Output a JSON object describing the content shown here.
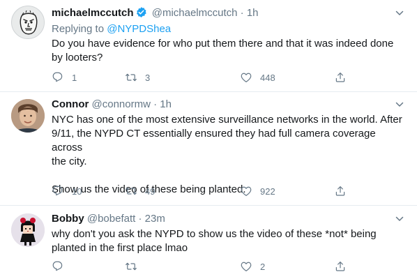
{
  "tweets": [
    {
      "name": "michaelmccutch",
      "verified": true,
      "handle": "@michaelmccutch",
      "separator": "·",
      "time": "1h",
      "replying_prefix": "Replying to",
      "replying_to": "@NYPDShea",
      "text_lines": [
        "Do you have evidence for who put them there and that it was indeed done",
        "by looters?"
      ],
      "replies": "1",
      "retweets": "3",
      "likes": "448"
    },
    {
      "name": "Connor",
      "handle": "@connormw",
      "separator": "·",
      "time": "1h",
      "text_lines": [
        "NYC has one of the most extensive surveillance networks in the world. After",
        "9/11, the NYPD CT essentially ensured they had full camera coverage across",
        "the city.",
        "",
        "Show us the video of these being planted."
      ],
      "replies": "10",
      "retweets": "49",
      "likes": "922"
    },
    {
      "name": "Bobby",
      "handle": "@bobefatt",
      "separator": "·",
      "time": "23m",
      "text_lines": [
        "why don't you ask the NYPD to show us the video of these *not* being",
        "planted in the first place lmao"
      ],
      "replies": "",
      "retweets": "",
      "likes": "2"
    }
  ],
  "icons": {
    "reply": "reply-icon",
    "retweet": "retweet-icon",
    "like": "heart-icon",
    "share": "share-icon",
    "more": "chevron-down-icon",
    "verified": "verified-badge-icon"
  },
  "colors": {
    "link": "#1da1f2",
    "muted": "#657786",
    "text": "#14171a",
    "divider": "#e6ecf0",
    "verified": "#1da1f2"
  }
}
